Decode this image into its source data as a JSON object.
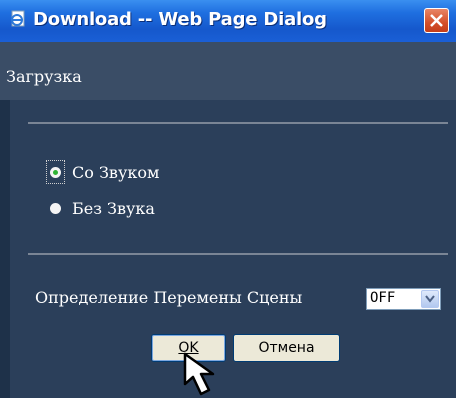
{
  "window": {
    "title": "Download -- Web Page Dialog",
    "close_icon": "close-icon"
  },
  "dialog": {
    "header": "Загрузка",
    "sound_options": [
      {
        "label": "Со Звуком",
        "selected": true
      },
      {
        "label": "Без Звука",
        "selected": false
      }
    ],
    "scene_change": {
      "label": "Определение Перемены Сцены",
      "selected_value": "OFF"
    },
    "buttons": {
      "ok_label": "OK",
      "cancel_label": "Отмена"
    }
  },
  "colors": {
    "titlebar": "#1f6fe0",
    "background": "#2b3f5a",
    "radio_selected": "#2fb334"
  }
}
